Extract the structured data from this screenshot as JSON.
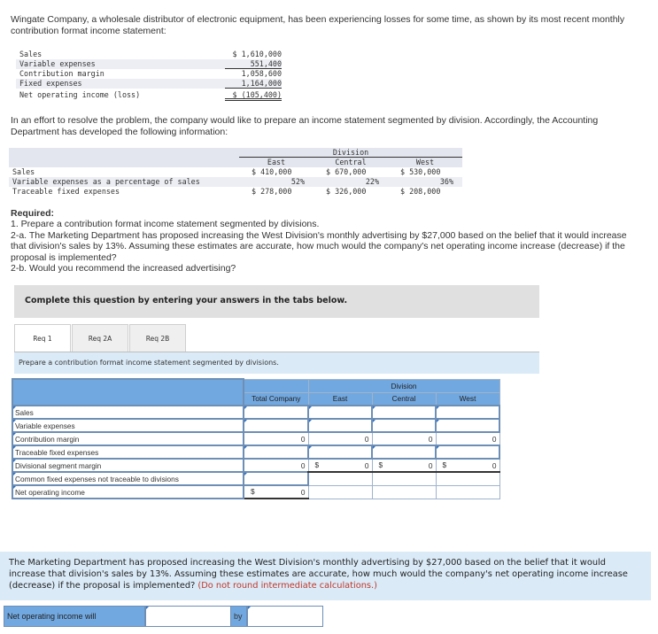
{
  "intro": "Wingate Company, a wholesale distributor of electronic equipment, has been experiencing losses for some time, as shown by its most recent monthly contribution format income statement:",
  "summary": {
    "rows": [
      {
        "label": "Sales",
        "value": "$ 1,610,000"
      },
      {
        "label": "Variable expenses",
        "value": "551,400"
      },
      {
        "label": "Contribution margin",
        "value": "1,058,600"
      },
      {
        "label": "Fixed expenses",
        "value": "1,164,000"
      },
      {
        "label": "Net operating income (loss)",
        "value": "$ (105,400)"
      }
    ]
  },
  "intro2": "In an effort to resolve the problem, the company would like to prepare an income statement segmented by division. Accordingly, the Accounting Department has developed the following information:",
  "division_info": {
    "group_header": "Division",
    "columns": [
      "East",
      "Central",
      "West"
    ],
    "rows": [
      {
        "label": "Sales",
        "values": [
          "$ 410,000",
          "$ 670,000",
          "$ 530,000"
        ]
      },
      {
        "label": "Variable expenses as a percentage of sales",
        "values": [
          "52%",
          "22%",
          "36%"
        ]
      },
      {
        "label": "Traceable fixed expenses",
        "values": [
          "$ 278,000",
          "$ 326,000",
          "$ 208,000"
        ]
      }
    ]
  },
  "required": {
    "title": "Required:",
    "items": [
      "1. Prepare a contribution format income statement segmented by divisions.",
      "2-a. The Marketing Department has proposed increasing the West Division's monthly advertising by $27,000 based on the belief that it would increase that division's sales by 13%. Assuming these estimates are accurate, how much would the company's net operating income increase (decrease) if the proposal is implemented?",
      "2-b. Would you recommend the increased advertising?"
    ]
  },
  "complete_banner": "Complete this question by entering your answers in the tabs below.",
  "tabs": [
    {
      "label": "Req 1",
      "active": true
    },
    {
      "label": "Req 2A",
      "active": false
    },
    {
      "label": "Req 2B",
      "active": false
    }
  ],
  "instruction": "Prepare a contribution format income statement segmented by divisions.",
  "answer_table": {
    "division_header": "Division",
    "headers": [
      "Total Company",
      "East",
      "Central",
      "West"
    ],
    "rows": [
      {
        "label": "Sales"
      },
      {
        "label": "Variable expenses"
      },
      {
        "label": "Contribution margin",
        "values": [
          "0",
          "0",
          "0",
          "0"
        ]
      },
      {
        "label": "Traceable fixed expenses"
      },
      {
        "label": "Divisional segment margin",
        "currency": "$",
        "values": [
          "0",
          "0",
          "0",
          "0"
        ]
      },
      {
        "label": "Common fixed expenses not traceable to divisions"
      },
      {
        "label": "Net operating income",
        "currency": "$",
        "values": [
          "0"
        ]
      }
    ]
  },
  "question2": {
    "text": "The Marketing Department has proposed increasing the West Division's monthly advertising by $27,000 based on the belief that it would increase that division's sales by 13%. Assuming these estimates are accurate, how much would the company's net operating income increase (decrease) if the proposal is implemented?",
    "note": "(Do not round intermediate calculations.)"
  },
  "answer_row": {
    "label": "Net operating income will",
    "by_label": "by",
    "select_value": "",
    "amount_value": ""
  }
}
